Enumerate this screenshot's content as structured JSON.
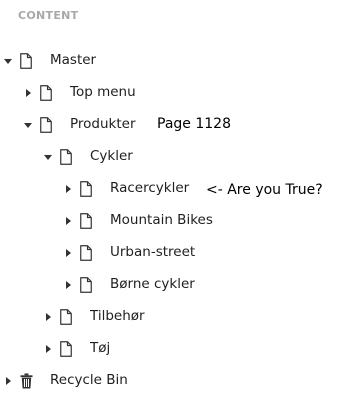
{
  "panel": {
    "header": "CONTENT"
  },
  "tree": {
    "master": {
      "label": "Master",
      "expanded": true,
      "icon": "document-icon"
    },
    "top_menu": {
      "label": "Top menu",
      "expanded": false,
      "icon": "document-icon"
    },
    "produkter": {
      "label": "Produkter",
      "expanded": true,
      "icon": "document-icon"
    },
    "cykler": {
      "label": "Cykler",
      "expanded": true,
      "icon": "document-icon"
    },
    "racercykler": {
      "label": "Racercykler",
      "expanded": false,
      "icon": "document-icon"
    },
    "mountain_bikes": {
      "label": "Mountain Bikes",
      "expanded": false,
      "icon": "document-icon"
    },
    "urban_street": {
      "label": "Urban-street",
      "expanded": false,
      "icon": "document-icon"
    },
    "borne_cykler": {
      "label": "Børne cykler",
      "expanded": false,
      "icon": "document-icon"
    },
    "tilbehor": {
      "label": "Tilbehør",
      "expanded": false,
      "icon": "document-icon"
    },
    "toj": {
      "label": "Tøj",
      "expanded": false,
      "icon": "document-icon"
    },
    "recycle_bin": {
      "label": "Recycle Bin",
      "expanded": false,
      "icon": "trash-icon"
    }
  },
  "annotations": {
    "produkter_note": "Page 1128",
    "racercykler_note": "<- Are you True?"
  }
}
